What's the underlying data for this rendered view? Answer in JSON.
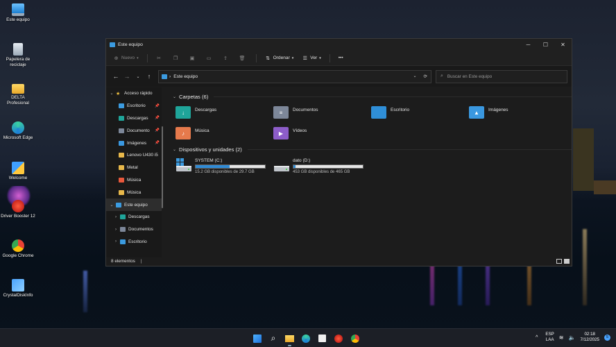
{
  "desktop": {
    "icons": [
      {
        "label": "Este equipo",
        "icon": "computer-icon"
      },
      {
        "label": "Papelera de reciclaje",
        "icon": "recycle-bin-icon"
      },
      {
        "label": "DELTA Profesional",
        "icon": "folder-icon"
      },
      {
        "label": "Microsoft Edge",
        "icon": "edge-icon"
      },
      {
        "label": "Welcome",
        "icon": "welcome-icon"
      },
      {
        "label": "Driver Booster 12",
        "icon": "driver-booster-icon"
      },
      {
        "label": "Google Chrome",
        "icon": "chrome-icon"
      },
      {
        "label": "CrystalDiskInfo",
        "icon": "crystaldiskinfo-icon"
      }
    ]
  },
  "window": {
    "title": "Este equipo",
    "toolbar": {
      "new_label": "Nuevo",
      "sort_label": "Ordenar",
      "view_label": "Ver",
      "more_label": "•••"
    },
    "address": {
      "separator": "›",
      "location": "Este equipo"
    },
    "search": {
      "placeholder": "Buscar en Este equipo"
    },
    "sidebar": {
      "items": [
        {
          "label": "Acceso rápido",
          "chevron": "⌄",
          "pinned": false
        },
        {
          "label": "Escritorio",
          "chevron": "",
          "pinned": true
        },
        {
          "label": "Descargas",
          "chevron": "",
          "pinned": true
        },
        {
          "label": "Documento",
          "chevron": "",
          "pinned": true
        },
        {
          "label": "Imágenes",
          "chevron": "",
          "pinned": true
        },
        {
          "label": "Lenovo U430 i5",
          "chevron": "",
          "pinned": false
        },
        {
          "label": "Metal",
          "chevron": "",
          "pinned": false
        },
        {
          "label": "Música",
          "chevron": "",
          "pinned": false
        },
        {
          "label": "Música",
          "chevron": "",
          "pinned": false
        },
        {
          "label": "Este equipo",
          "chevron": "⌄",
          "pinned": false
        },
        {
          "label": "Descargas",
          "chevron": "›",
          "pinned": false
        },
        {
          "label": "Documentos",
          "chevron": "›",
          "pinned": false
        },
        {
          "label": "Escritorio",
          "chevron": "›",
          "pinned": false
        }
      ]
    },
    "folders_group": {
      "title": "Carpetas (6)",
      "items": [
        {
          "label": "Descargas",
          "color": "#1fa59a",
          "glyph": "↓"
        },
        {
          "label": "Documentos",
          "color": "#7d8799",
          "glyph": "≡"
        },
        {
          "label": "Escritorio",
          "color": "#2f8fd8",
          "glyph": ""
        },
        {
          "label": "Imágenes",
          "color": "#3a98e0",
          "glyph": "▲"
        },
        {
          "label": "Música",
          "color": "#e67a4c",
          "glyph": "♪"
        },
        {
          "label": "Vídeos",
          "color": "#8d5dc9",
          "glyph": "▶"
        }
      ]
    },
    "drives_group": {
      "title": "Dispositivos y unidades (2)",
      "items": [
        {
          "name": "SYSTEM (C:)",
          "free": "15.2 GB disponibles de 29.7 GB",
          "used_fraction": 0.49
        },
        {
          "name": "dato (D:)",
          "free": "453 GB disponibles de 465 GB",
          "used_fraction": 0.03
        }
      ]
    },
    "status": {
      "count": "8 elementos",
      "sep": "|"
    }
  },
  "taskbar": {
    "apps": [
      "windows-start-icon",
      "search-icon",
      "file-explorer-icon",
      "edge-icon",
      "store-icon",
      "driver-booster-icon",
      "chrome-icon"
    ],
    "tray": {
      "chevron": "^",
      "lang_top": "ESP",
      "lang_bottom": "LAA",
      "time": "02:18",
      "date": "7/12/2025",
      "notifications": "5"
    }
  }
}
